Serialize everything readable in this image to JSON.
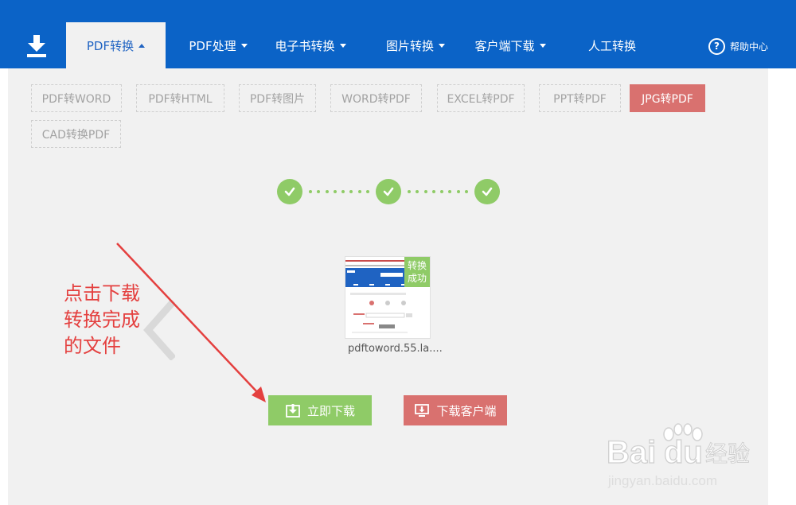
{
  "nav": {
    "items": [
      {
        "label": "PDF转换",
        "caret": "up"
      },
      {
        "label": "PDF处理",
        "caret": "down"
      },
      {
        "label": "电子书转换",
        "caret": "down"
      },
      {
        "label": "图片转换",
        "caret": "down"
      },
      {
        "label": "客户端下载",
        "caret": "down"
      },
      {
        "label": "人工转换",
        "caret": ""
      }
    ],
    "help_label": "帮助中心",
    "help_icon": "?"
  },
  "tools": [
    "PDF转WORD",
    "PDF转HTML",
    "PDF转图片",
    "WORD转PDF",
    "EXCEL转PDF",
    "PPT转PDF",
    "JPG转PDF",
    "CAD转换PDF"
  ],
  "active_tool": "JPG转PDF",
  "steps": {
    "count": 3,
    "completed": 3
  },
  "thumbnail": {
    "badge_line1": "转换",
    "badge_line2": "成功",
    "file_name": "pdftoword.55.la...."
  },
  "buttons": {
    "download_now": "立即下载",
    "download_client": "下载客户端"
  },
  "annotation": {
    "line1": "点击下载",
    "line2": "转换完成",
    "line3": "的文件"
  },
  "watermark": {
    "brand": "Baidu",
    "suffix": "经验",
    "url": "jingyan.baidu.com"
  },
  "colors": {
    "nav_bg": "#0b63c7",
    "active_tab_text": "#1f63c2",
    "success_green": "#8fcb67",
    "accent_red": "#d9716f",
    "annotation_red": "#e4403f"
  }
}
